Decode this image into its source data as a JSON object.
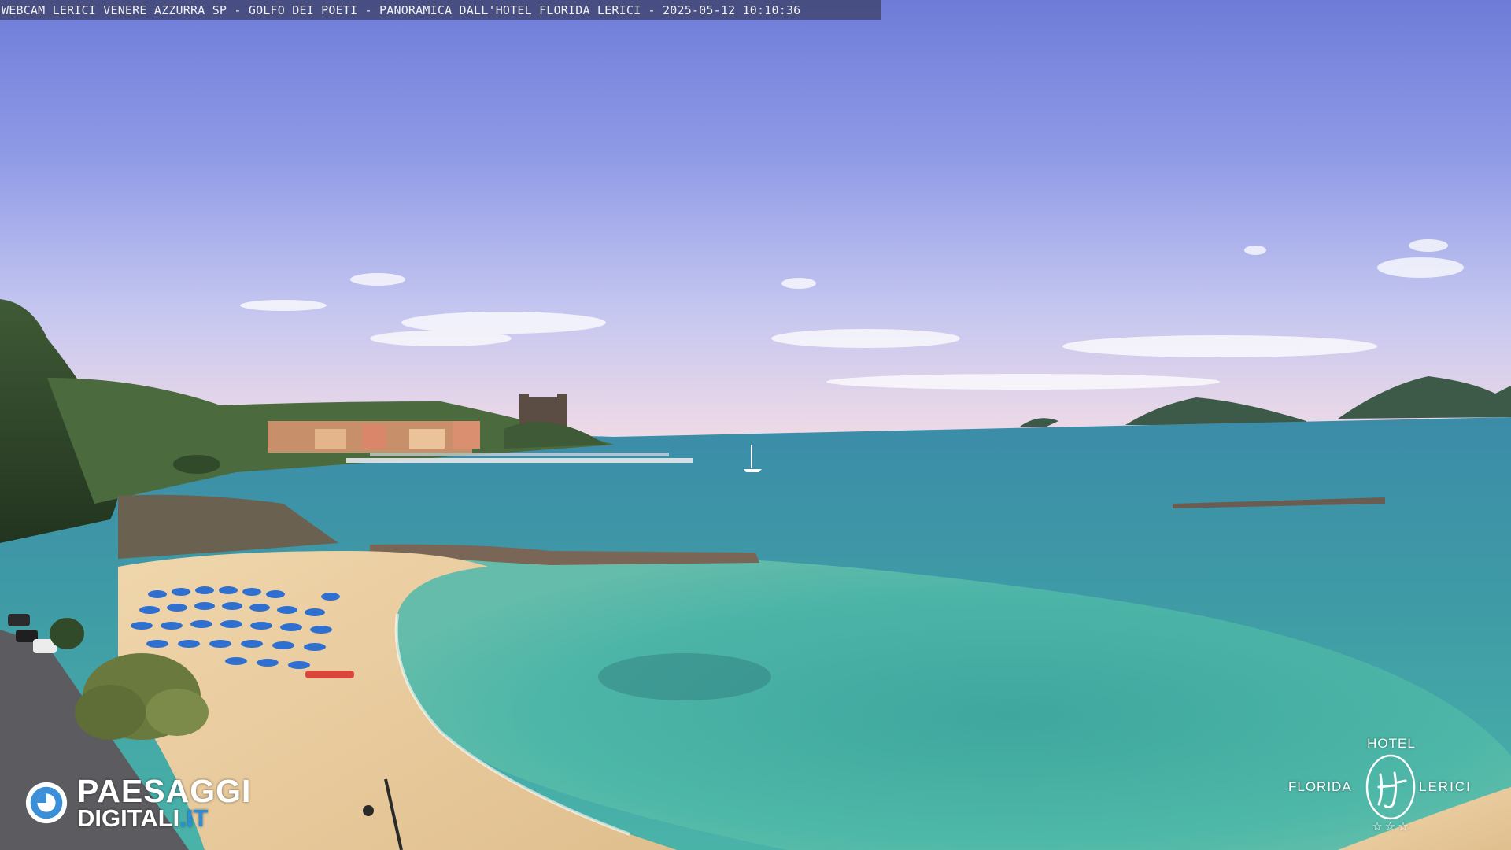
{
  "overlay": {
    "caption": "WEBCAM LERICI VENERE AZZURRA SP - GOLFO DEI POETI - PANORAMICA DALL'HOTEL FLORIDA LERICI - 2025-05-12 10:10:36"
  },
  "watermark_left": {
    "line1": "PAESAGGI",
    "line2_main": "DIGITALI",
    "line2_tld": ".IT"
  },
  "watermark_right": {
    "top": "HOTEL",
    "left": "FLORIDA",
    "right": "LERICI",
    "stars": "☆☆☆"
  },
  "colors": {
    "sky_top": "#7a86dc",
    "sky_horizon": "#eed8e6",
    "sea_deep": "#3a8fa0",
    "sea_shallow": "#47b0a8",
    "sand": "#e8c99a",
    "umbrella": "#2f6fd0",
    "brand_accent": "#2a8fe0"
  }
}
